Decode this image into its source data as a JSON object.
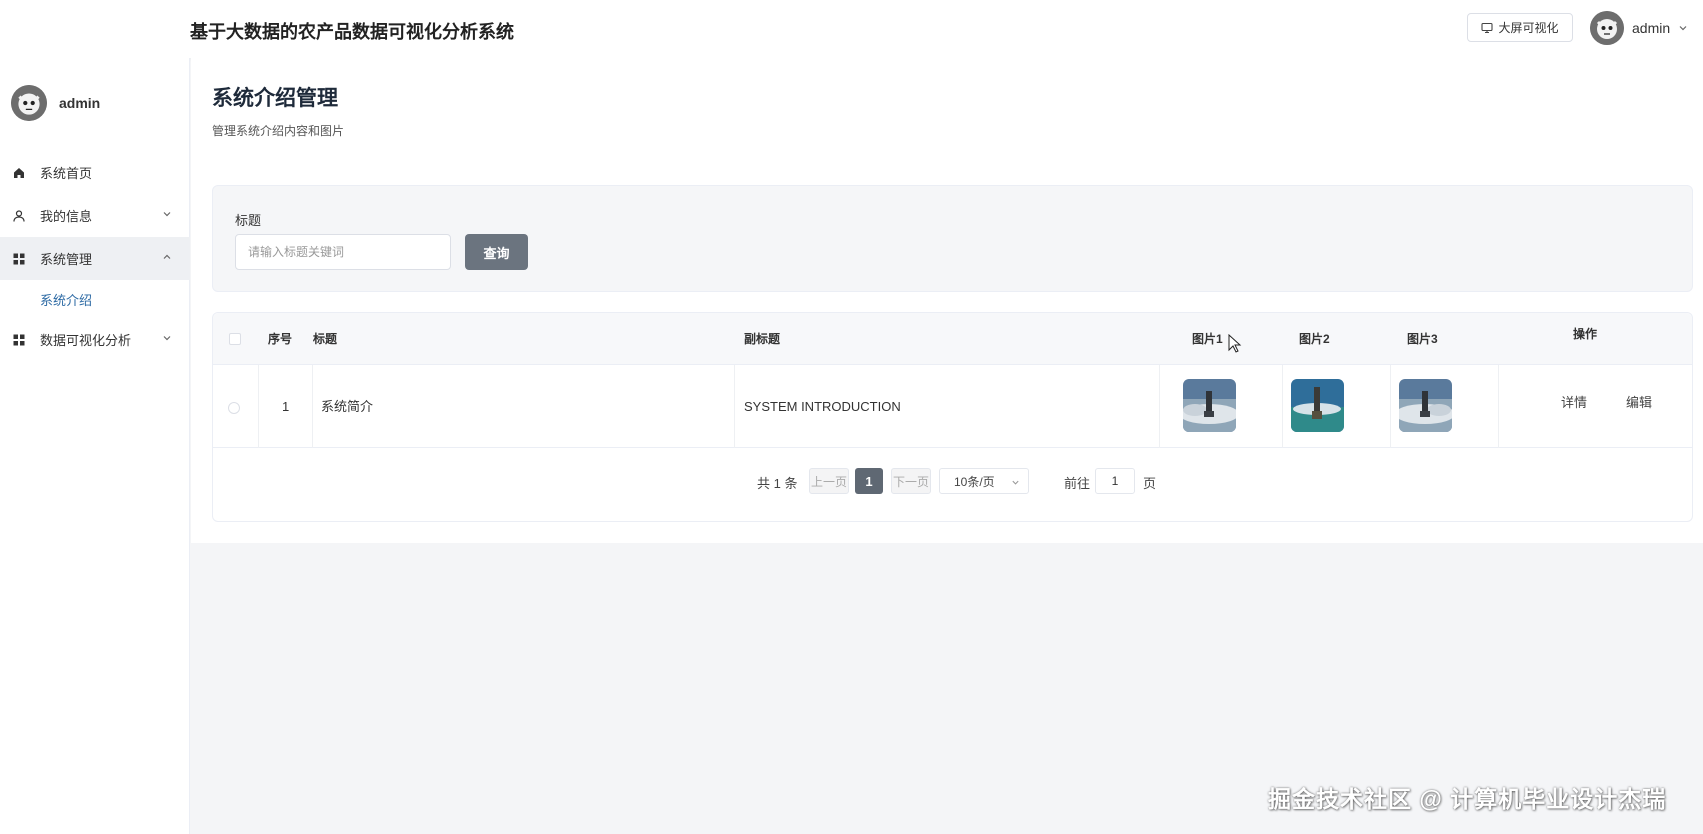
{
  "header": {
    "app_title": "基于大数据的农产品数据可视化分析系统",
    "bigscreen_label": "大屏可视化",
    "username": "admin"
  },
  "sidebar": {
    "username": "admin",
    "items": [
      {
        "label": "系统首页",
        "icon": "home-icon"
      },
      {
        "label": "我的信息",
        "icon": "user-icon",
        "arrow": "chevron-down"
      },
      {
        "label": "系统管理",
        "icon": "grid-icon",
        "arrow": "chevron-up",
        "active": true
      },
      {
        "label": "数据可视化分析",
        "icon": "grid-icon",
        "arrow": "chevron-down"
      }
    ],
    "sub_item": "系统介绍"
  },
  "page": {
    "title": "系统介绍管理",
    "subtitle": "管理系统介绍内容和图片"
  },
  "search": {
    "label": "标题",
    "placeholder": "请输入标题关键词",
    "button": "查询"
  },
  "table": {
    "columns": [
      "序号",
      "标题",
      "副标题",
      "图片1",
      "图片2",
      "图片3",
      "操作"
    ],
    "rows": [
      {
        "index": "1",
        "title": "系统简介",
        "subtitle": "SYSTEM INTRODUCTION",
        "actions": [
          "详情",
          "编辑"
        ]
      }
    ]
  },
  "pagination": {
    "total": "共 1 条",
    "prev": "上一页",
    "current": "1",
    "next": "下一页",
    "page_size": "10条/页",
    "goto_label": "前往",
    "goto_value": "1",
    "page_unit": "页"
  },
  "watermark": "掘金技术社区 @ 计算机毕业设计杰瑞",
  "colors": {
    "primary_button": "#6b747f",
    "active_page": "#5f6873",
    "submenu_text": "#2d6aa4",
    "background": "#f4f5f7"
  }
}
